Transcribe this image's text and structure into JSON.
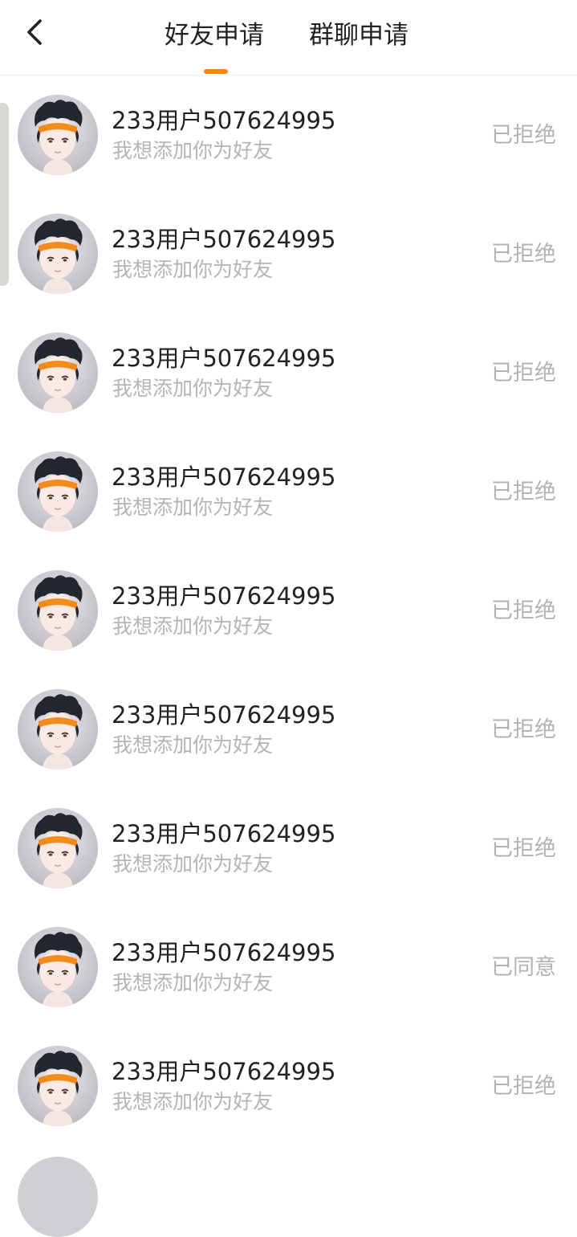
{
  "header": {
    "tabs": [
      {
        "label": "好友申请",
        "active": true
      },
      {
        "label": "群聊申请",
        "active": false
      }
    ],
    "back_icon": "chevron-left-icon",
    "accent_color": "#ff8412"
  },
  "requests": [
    {
      "name": "233用户507624995",
      "message": "我想添加你为好友",
      "status": "已拒绝"
    },
    {
      "name": "233用户507624995",
      "message": "我想添加你为好友",
      "status": "已拒绝"
    },
    {
      "name": "233用户507624995",
      "message": "我想添加你为好友",
      "status": "已拒绝"
    },
    {
      "name": "233用户507624995",
      "message": "我想添加你为好友",
      "status": "已拒绝"
    },
    {
      "name": "233用户507624995",
      "message": "我想添加你为好友",
      "status": "已拒绝"
    },
    {
      "name": "233用户507624995",
      "message": "我想添加你为好友",
      "status": "已拒绝"
    },
    {
      "name": "233用户507624995",
      "message": "我想添加你为好友",
      "status": "已拒绝"
    },
    {
      "name": "233用户507624995",
      "message": "我想添加你为好友",
      "status": "已同意"
    },
    {
      "name": "233用户507624995",
      "message": "我想添加你为好友",
      "status": "已拒绝"
    }
  ]
}
